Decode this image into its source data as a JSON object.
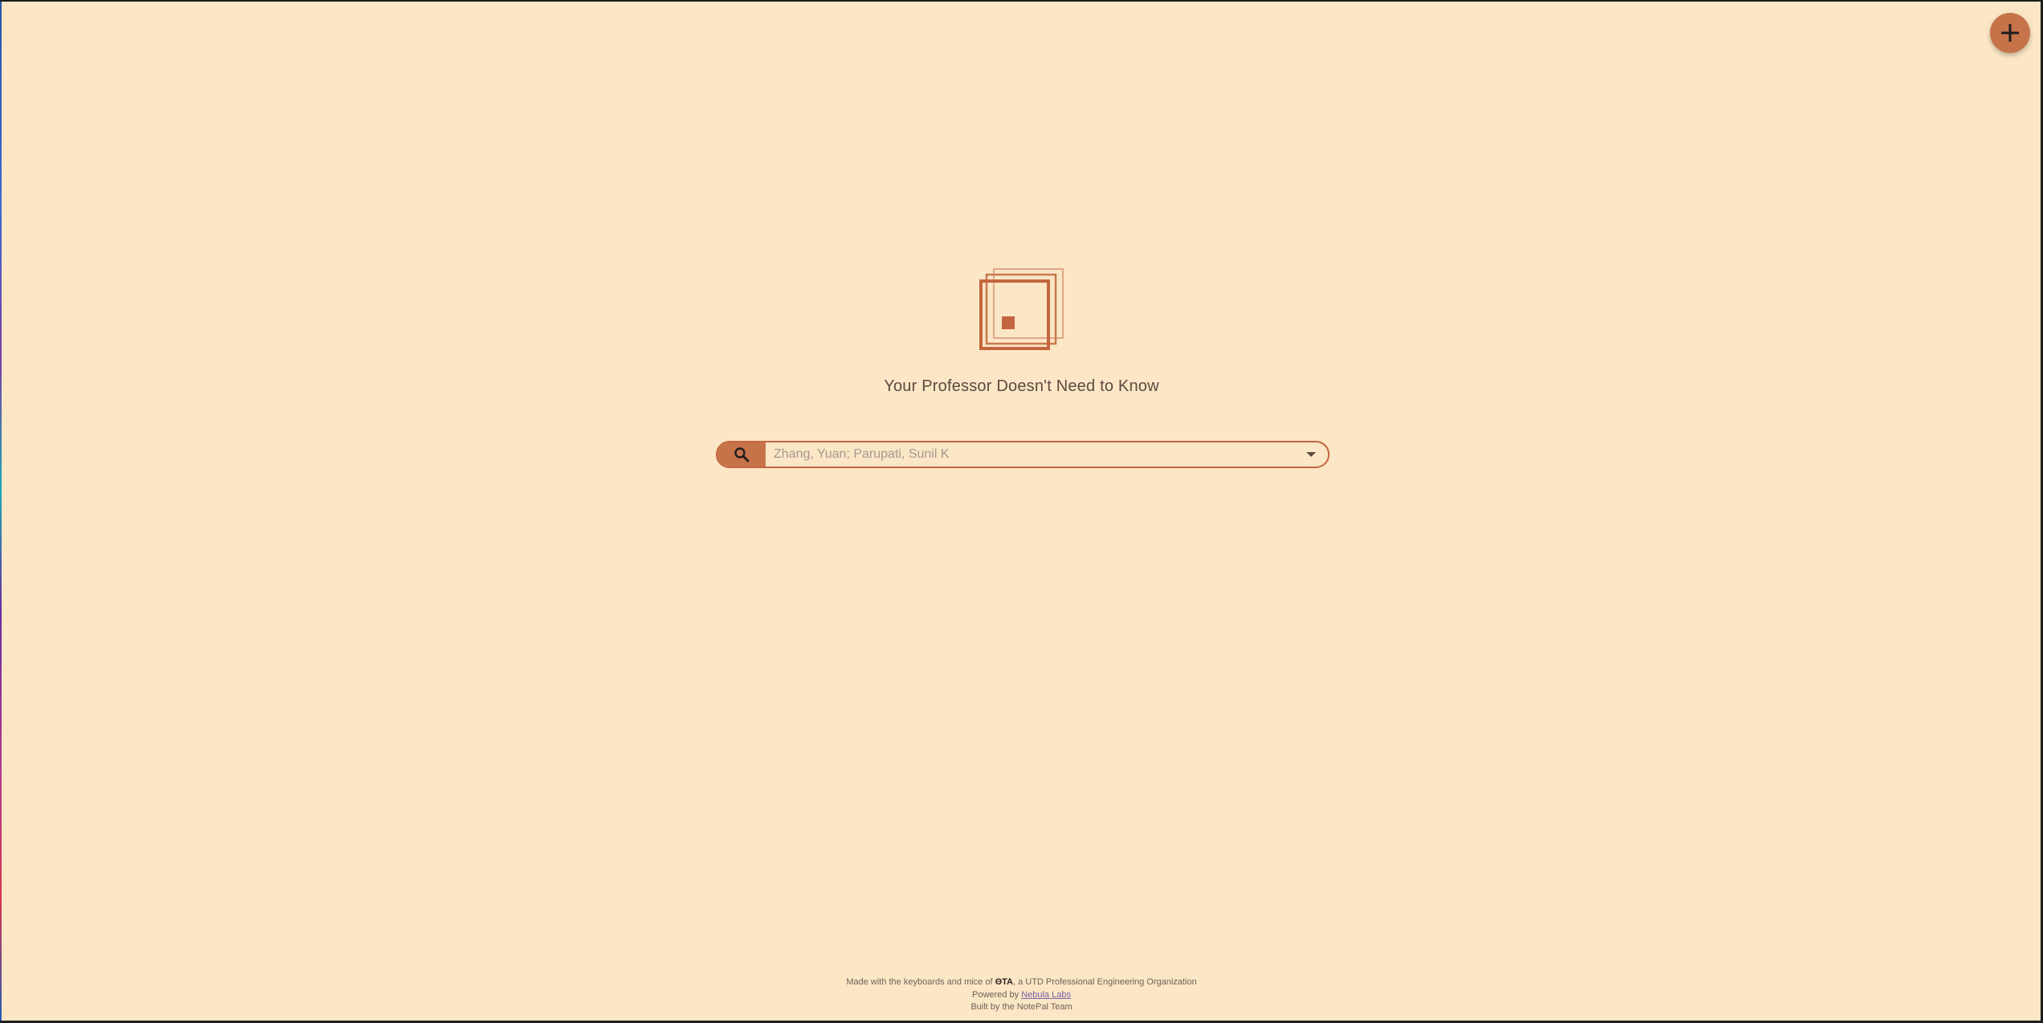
{
  "header": {
    "add_button_icon": "plus-icon"
  },
  "hero": {
    "logo_icon": "stacked-squares-logo",
    "tagline": "Your Professor Doesn't Need to Know"
  },
  "search": {
    "button_icon": "search-icon",
    "placeholder": "Zhang, Yuan; Parupati, Sunil K",
    "value": "",
    "dropdown_icon": "chevron-down-icon"
  },
  "footer": {
    "line1_prefix": "Made with the keyboards and mice of ",
    "line1_org": "ΘTA",
    "line1_suffix": ", a UTD Professional Engineering Organization",
    "line2_prefix": "Powered by ",
    "line2_link": "Nebula Labs",
    "line3": "Built by the NotePal Team"
  },
  "colors": {
    "background": "#fbe6c5",
    "accent": "#c7734a",
    "text": "#5c4a40"
  }
}
